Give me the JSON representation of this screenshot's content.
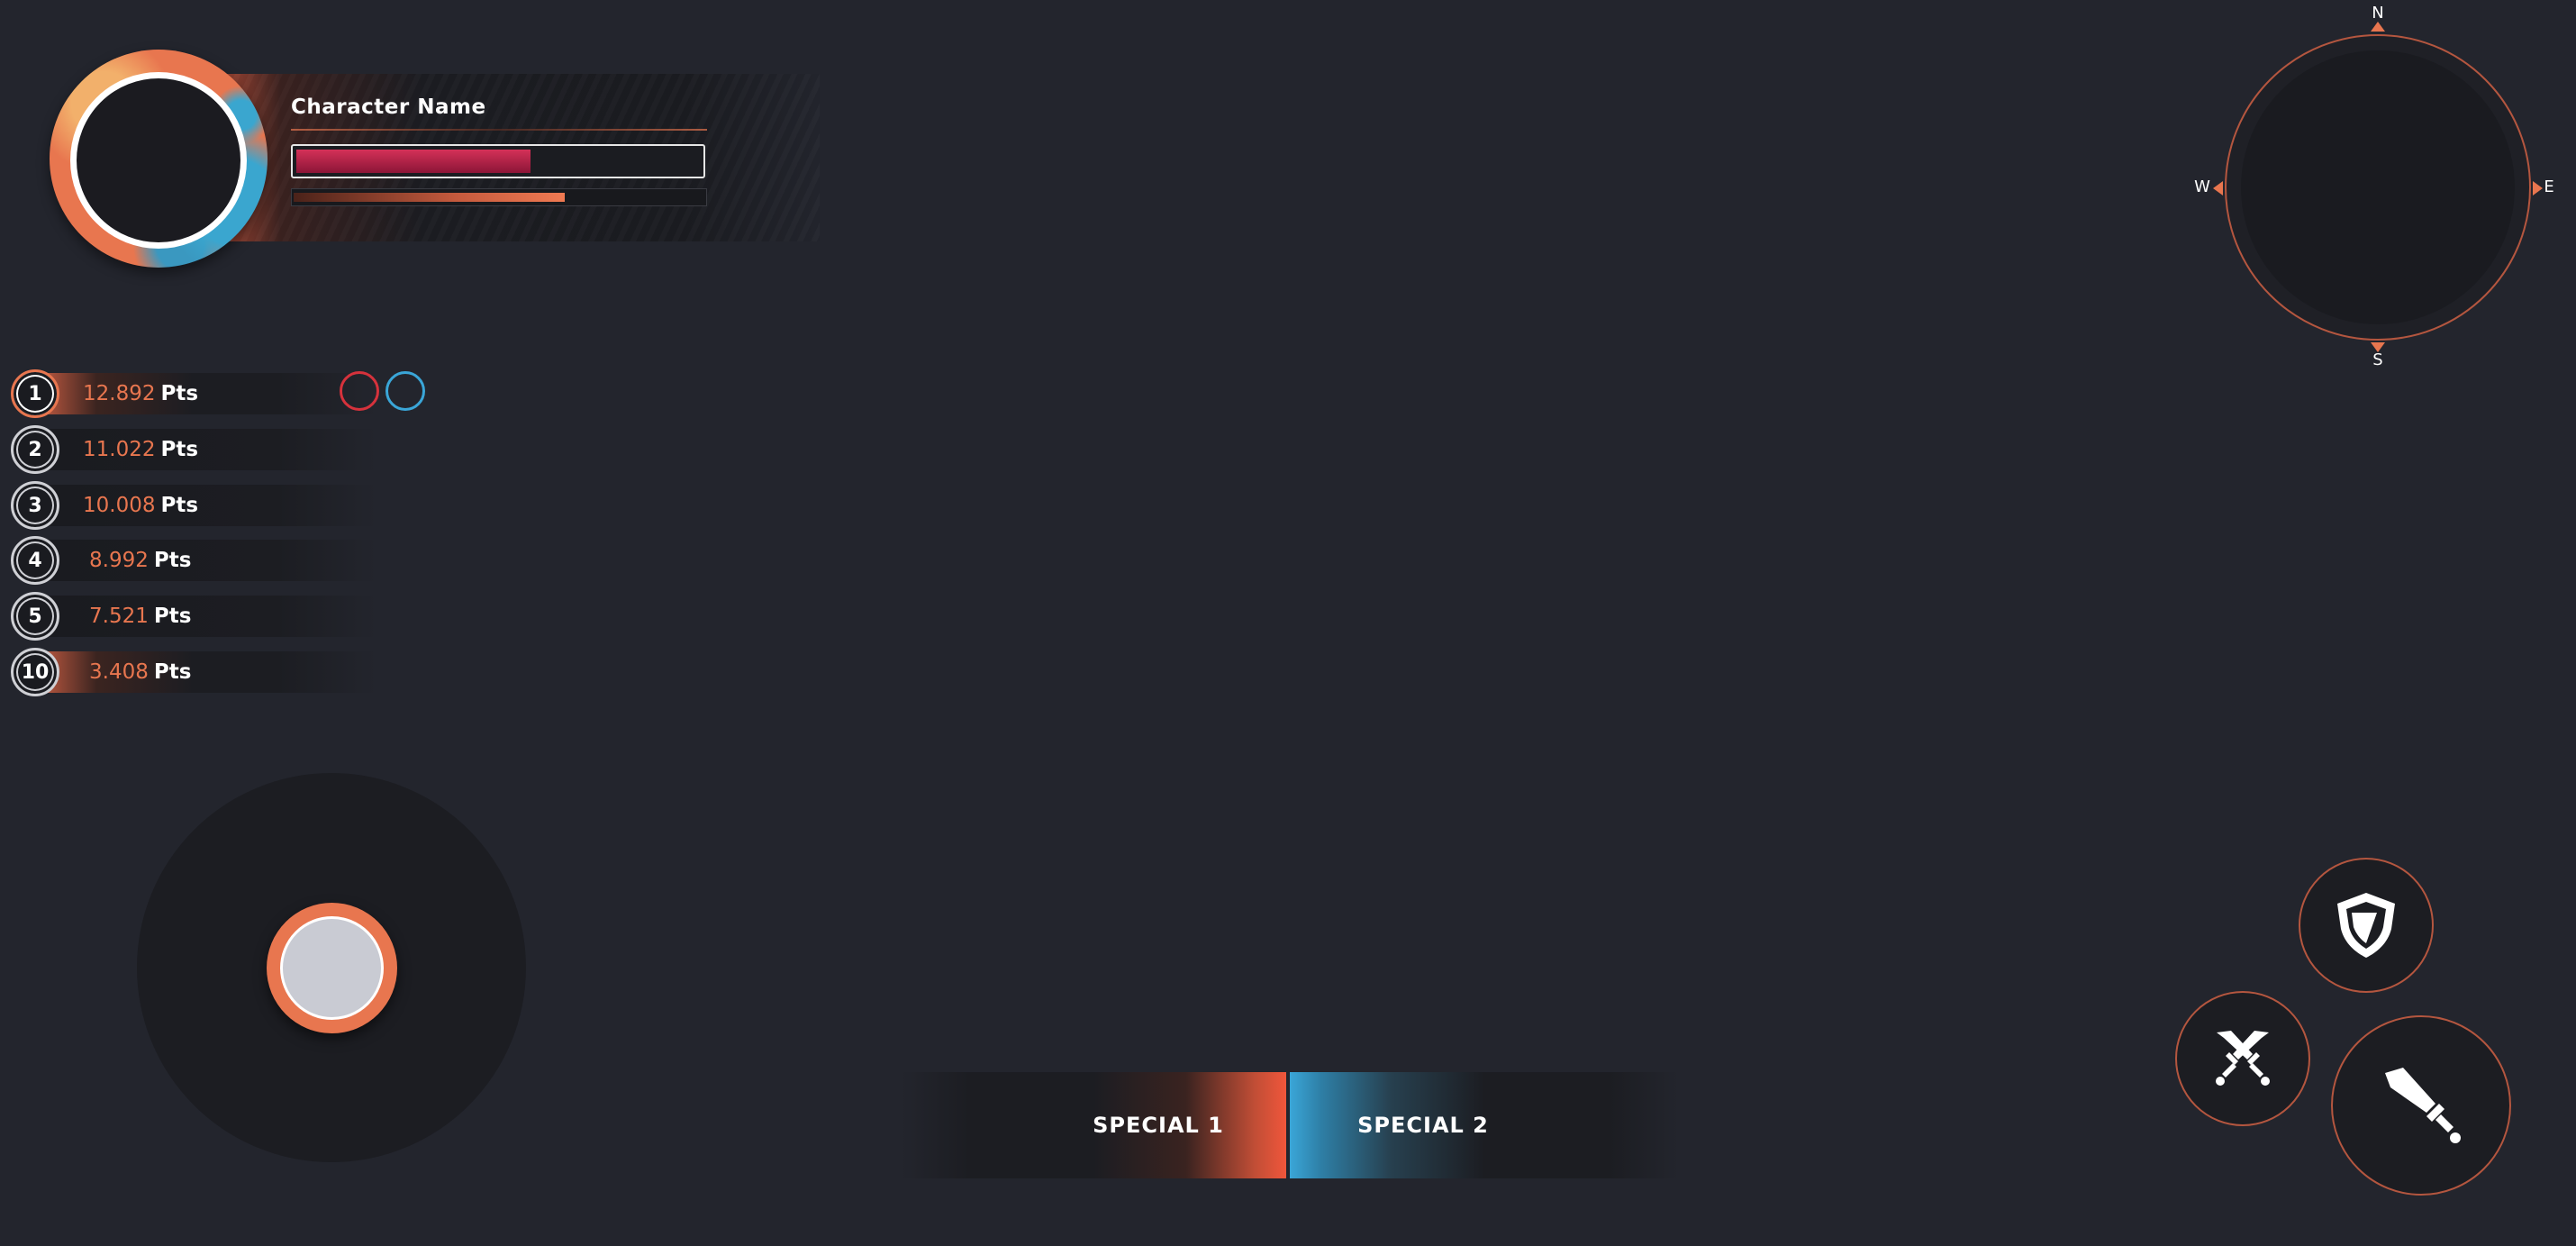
{
  "character": {
    "name": "Character Name",
    "health_fraction": 0.58,
    "energy_fraction": 0.66
  },
  "leaderboard": [
    {
      "rank": "1",
      "score": "12.892",
      "unit": "Pts"
    },
    {
      "rank": "2",
      "score": "11.022",
      "unit": "Pts"
    },
    {
      "rank": "3",
      "score": "10.008",
      "unit": "Pts"
    },
    {
      "rank": "4",
      "score": "8.992",
      "unit": "Pts"
    },
    {
      "rank": "5",
      "score": "7.521",
      "unit": "Pts"
    },
    {
      "rank": "10",
      "score": "3.408",
      "unit": "Pts"
    }
  ],
  "teams": {
    "red": "#d6323c",
    "blue": "#3aa6d8"
  },
  "specials": {
    "special_1": "SPECIAL 1",
    "special_2": "SPECIAL 2"
  },
  "actions": {
    "shield": "shield-icon",
    "dual": "crossed-swords-icon",
    "sword": "sword-icon"
  },
  "compass": {
    "north": "N",
    "south": "S",
    "east": "E",
    "west": "W"
  },
  "colors": {
    "background": "#23252d",
    "accent_orange": "#e8764f",
    "accent_blue": "#3aa6d8",
    "health": "#d43158",
    "panel": "#1c1d22"
  }
}
